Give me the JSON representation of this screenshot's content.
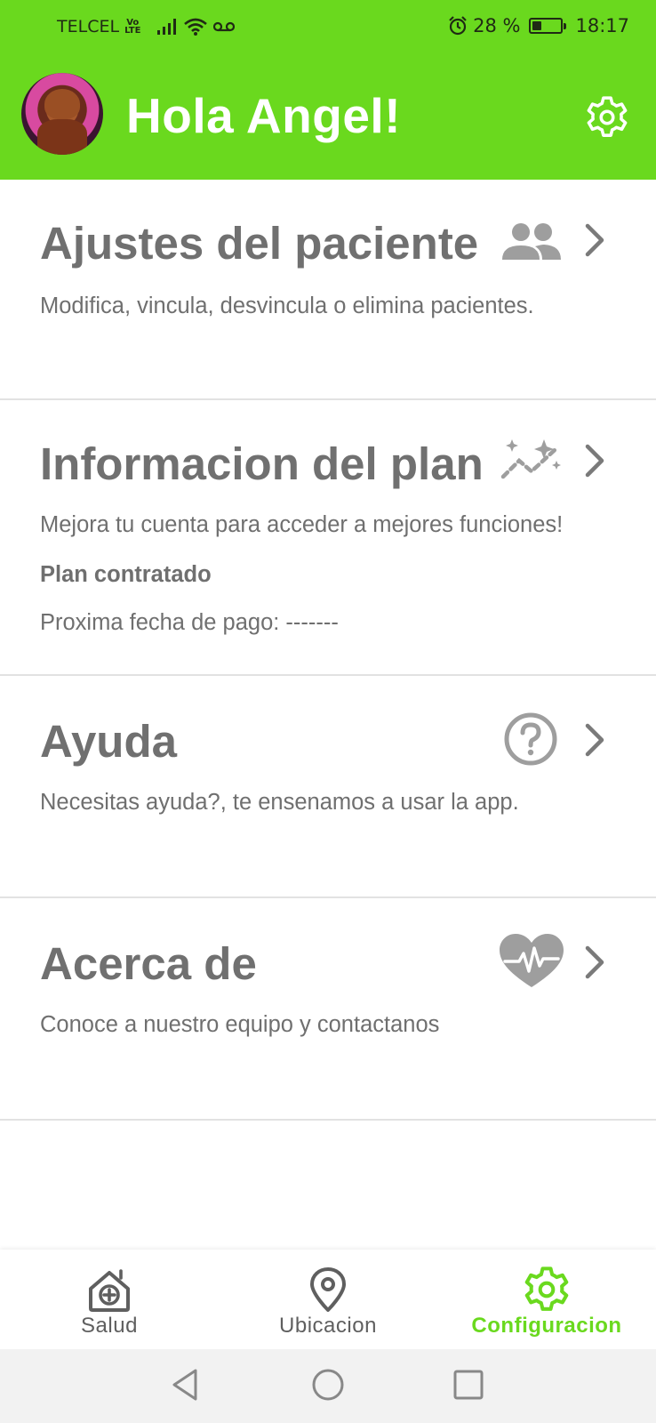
{
  "status_bar": {
    "carrier": "TELCEL",
    "volte_top": "Vo",
    "volte_bottom": "LTE",
    "battery_percent": "28 %",
    "battery_level": 0.28,
    "time": "18:17"
  },
  "header": {
    "greeting": "Hola Angel!",
    "background_color": "#6ad91e"
  },
  "sections": [
    {
      "title": "Ajustes del paciente",
      "description": "Modifica, vincula, desvincula o elimina pacientes.",
      "icon": "people-icon"
    },
    {
      "title": "Informacion del plan",
      "description": "Mejora tu cuenta para acceder a mejores funciones!",
      "plan_label": "Plan contratado",
      "next_payment": "Proxima fecha de pago: -------",
      "icon": "sparkle-chart-icon"
    },
    {
      "title": "Ayuda",
      "description": "Necesitas ayuda?, te ensenamos a usar la app.",
      "icon": "help-circle-icon"
    },
    {
      "title": "Acerca de",
      "description": "Conoce a nuestro equipo y contactanos",
      "icon": "heart-pulse-icon"
    }
  ],
  "bottom_nav": {
    "items": [
      {
        "label": "Salud",
        "icon": "health-home-icon",
        "active": false
      },
      {
        "label": "Ubicacion",
        "icon": "location-pin-icon",
        "active": false
      },
      {
        "label": "Configuracion",
        "icon": "gear-icon",
        "active": true
      }
    ],
    "active_color": "#6ad91e"
  },
  "system_nav": {
    "buttons": [
      "back-icon",
      "home-icon",
      "recents-icon"
    ]
  }
}
